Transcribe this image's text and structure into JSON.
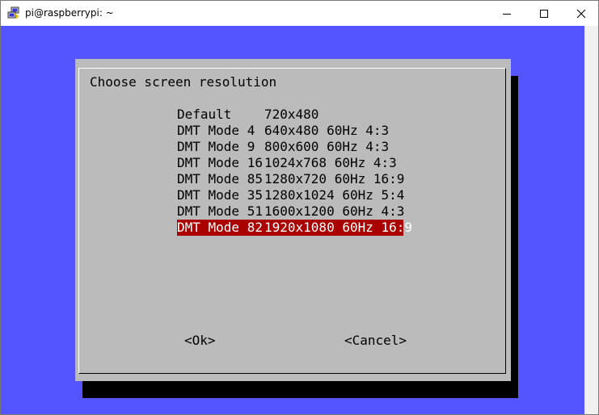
{
  "window": {
    "title": "pi@raspberrypi: ~",
    "icon": "putty-icon",
    "controls": [
      "minimize-icon",
      "maximize-icon",
      "close-icon"
    ]
  },
  "dialog": {
    "title": "Choose screen resolution",
    "items": [
      {
        "mode": "Default",
        "resolution": "720x480",
        "selected": false
      },
      {
        "mode": "DMT Mode 4",
        "resolution": "640x480 60Hz 4:3",
        "selected": false
      },
      {
        "mode": "DMT Mode 9",
        "resolution": "800x600 60Hz 4:3",
        "selected": false
      },
      {
        "mode": "DMT Mode 16",
        "resolution": "1024x768 60Hz 4:3",
        "selected": false
      },
      {
        "mode": "DMT Mode 85",
        "resolution": "1280x720 60Hz 16:9",
        "selected": false
      },
      {
        "mode": "DMT Mode 35",
        "resolution": "1280x1024 60Hz 5:4",
        "selected": false
      },
      {
        "mode": "DMT Mode 51",
        "resolution": "1600x1200 60Hz 4:3",
        "selected": false
      },
      {
        "mode": "DMT Mode 82",
        "resolution": "1920x1080 60Hz 16:9",
        "selected": true
      }
    ],
    "ok_label": "<Ok>",
    "cancel_label": "<Cancel>"
  },
  "colors": {
    "terminal_background": "#5555ff",
    "dialog_background": "#bbbbbb",
    "selection": "#aa0000",
    "shadow": "#000000"
  }
}
